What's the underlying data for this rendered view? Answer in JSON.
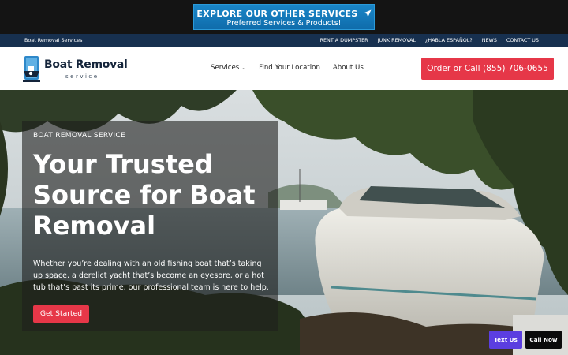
{
  "promo": {
    "title": "EXPLORE OUR OTHER SERVICES",
    "subtitle": "Preferred Services & Products!",
    "icon": "paper-plane-icon"
  },
  "utility": {
    "brand": "Boat Removal Services",
    "links": [
      "RENT A DUMPSTER",
      "JUNK REMOVAL",
      "¿HABLA ESPAÑOL?",
      "NEWS",
      "CONTACT US"
    ]
  },
  "header": {
    "logo_name": "Boat Removal",
    "logo_tag": "service",
    "logo_icon": "boat-removal-logo-icon",
    "nav": {
      "services": "Services",
      "find_location": "Find Your Location",
      "about": "About Us"
    },
    "cta": "Order or Call (855) 706-0655"
  },
  "hero": {
    "eyebrow": "BOAT REMOVAL SERVICE",
    "headline": "Your Trusted Source for Boat Removal",
    "body": "Whether you’re dealing with an old fishing boat that’s taking up space, a derelict yacht that’s become an eyesore, or a hot tub that’s past its prime, our professional team is here to help.",
    "button": "Get Started"
  },
  "floating": {
    "text_us": "Text Us",
    "call_now": "Call Now"
  },
  "colors": {
    "accent_red": "#e63748",
    "navy": "#17304f",
    "promo_blue": "#1a86c8",
    "text_us_purple": "#5b3ee0"
  }
}
